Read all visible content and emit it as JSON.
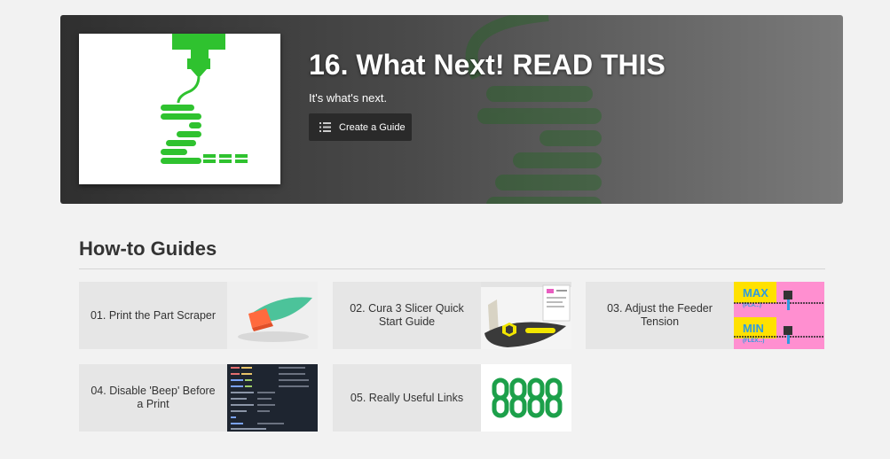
{
  "hero": {
    "title": "16. What Next! READ THIS",
    "subtitle": "It's what's next.",
    "create_button_label": "Create a Guide"
  },
  "section": {
    "title": "How-to Guides"
  },
  "guides": [
    {
      "label": "01. Print the Part Scraper"
    },
    {
      "label": "02. Cura 3 Slicer Quick Start Guide"
    },
    {
      "label": "03. Adjust the Feeder Tension"
    },
    {
      "label": "04. Disable 'Beep' Before a Print"
    },
    {
      "label": "05. Really Useful Links"
    }
  ],
  "thumb_text": {
    "max": "MAX",
    "pla": "(PLA...)",
    "min": "MIN",
    "flex": "(FLEX...)"
  },
  "colors": {
    "accent_green": "#2fc22f",
    "card_bg": "#e6e6e6",
    "page_bg": "#f2f2f2"
  }
}
